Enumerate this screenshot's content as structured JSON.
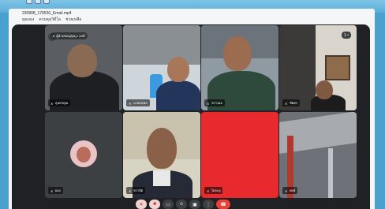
{
  "window": {
    "title": "230808_170520_Email.mp4",
    "title_prefix_icons": [
      "back-icon",
      "forward-icon"
    ],
    "menu": [
      "มุมมอง",
      "ควบคุมวิดีโอ",
      "ช่วยเหลือ"
    ]
  },
  "meeting": {
    "pinned_label": "ผู้นำเสนอ(คุณ) • แชร์",
    "corner_label": "1 •",
    "participants": [
      {
        "name": "สุนทรคุณ",
        "muted": true
      },
      {
        "name": "นายธนพล",
        "muted": true
      },
      {
        "name": "ชวานเจ",
        "muted": true
      },
      {
        "name": "ชัยพร",
        "muted": true
      },
      {
        "name": "ผอง",
        "muted": true
      },
      {
        "name": "ชวาลิต",
        "muted": true
      },
      {
        "name": "ไม่ระบุ",
        "muted": true
      },
      {
        "name": "พงษ์",
        "muted": true
      }
    ],
    "toolbar": [
      "mic-off",
      "camera-off",
      "cc",
      "emoji",
      "present",
      "more",
      "end-call"
    ]
  },
  "colors": {
    "meet_bg": "#202124",
    "red_tile": "#e8292e",
    "end_call": "#ea4335"
  }
}
